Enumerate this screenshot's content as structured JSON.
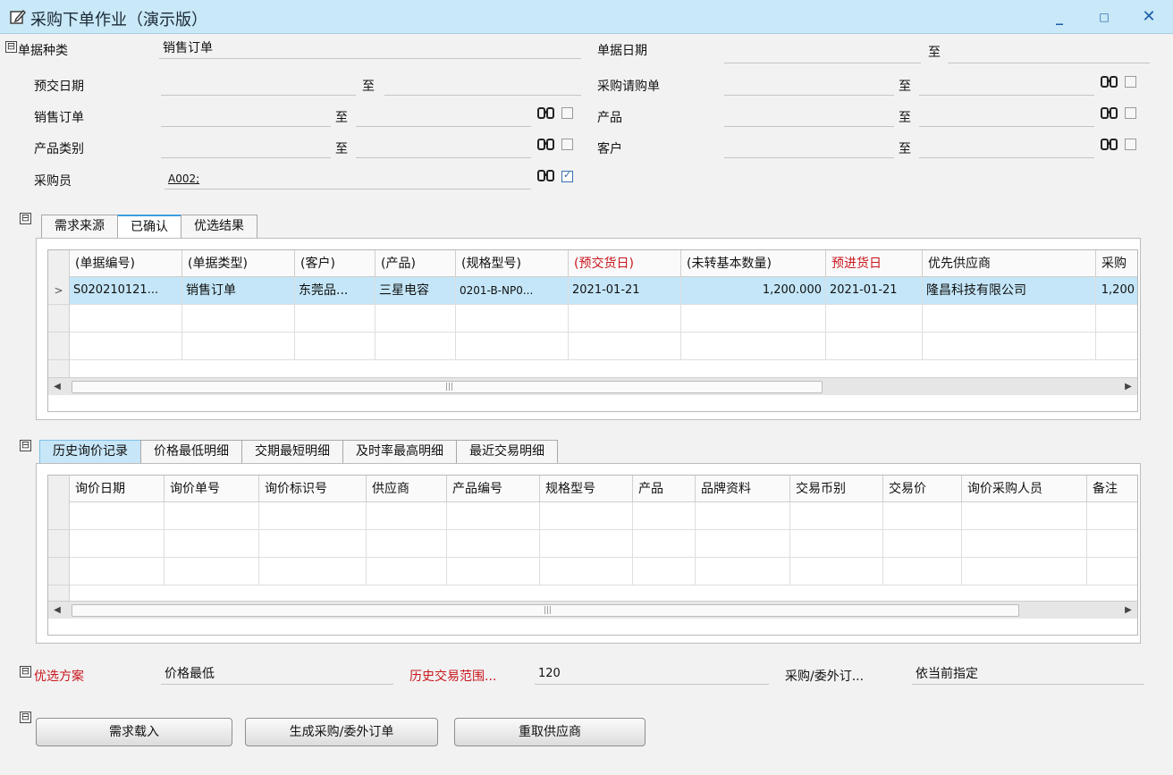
{
  "window": {
    "title": "采购下单作业（演示版）",
    "min_glyph": "_",
    "max_glyph": "□",
    "close_glyph": "✕"
  },
  "icons": {
    "edit": "edit-icon",
    "binoculars": "binoculars-icon",
    "collapse": "collapse-icon"
  },
  "filters": {
    "doc_type": {
      "label": "单据种类",
      "value": "销售订单"
    },
    "doc_date": {
      "label": "单据日期",
      "from": "",
      "to_label": "至",
      "to": ""
    },
    "delivery_date": {
      "label": "预交日期",
      "from": "",
      "to_label": "至",
      "to": ""
    },
    "purchase_request": {
      "label": "采购请购单",
      "from": "",
      "to_label": "至",
      "to": ""
    },
    "sales_order": {
      "label": "销售订单",
      "from": "",
      "to_label": "至",
      "to": ""
    },
    "product": {
      "label": "产品",
      "from": "",
      "to_label": "至",
      "to": ""
    },
    "product_category": {
      "label": "产品类别",
      "from": "",
      "to_label": "至",
      "to": ""
    },
    "customer": {
      "label": "客户",
      "from": "",
      "to_label": "至",
      "to": ""
    },
    "buyer": {
      "label": "采购员",
      "value": "A002;"
    },
    "binoculars_text": "M",
    "collapse_glyph": "⊟"
  },
  "tabs_top": [
    "需求来源",
    "已确认",
    "优选结果"
  ],
  "grid_top": {
    "columns": [
      "(单据编号)",
      "(单据类型)",
      "(客户)",
      "(产品)",
      "(规格型号)",
      "(预交货日)",
      "(未转基本数量)",
      "预进货日",
      "优先供应商",
      "采购"
    ],
    "rows": [
      [
        "S020210121...",
        "销售订单",
        "东莞品...",
        "三星电容",
        "0201-B-NP0...",
        "2021-01-21",
        "1,200.000",
        "2021-01-21",
        "隆昌科技有限公司",
        "1,200"
      ]
    ],
    "row_marker": ">",
    "scroll_left": "◀",
    "scroll_right": "▶",
    "scroll_grip": "|||"
  },
  "tabs_bottom": [
    "历史询价记录",
    "价格最低明细",
    "交期最短明细",
    "及时率最高明细",
    "最近交易明细"
  ],
  "grid_bottom": {
    "columns": [
      "询价日期",
      "询价单号",
      "询价标识号",
      "供应商",
      "产品编号",
      "规格型号",
      "产品",
      "品牌资料",
      "交易币别",
      "交易价",
      "询价采购人员",
      "备注"
    ]
  },
  "options": {
    "preferred_scheme": {
      "label": "优选方案",
      "value": "价格最低"
    },
    "history_range": {
      "label": "历史交易范围...",
      "value": "120"
    },
    "purchase_outsource": {
      "label": "采购/委外订...",
      "value": "依当前指定"
    }
  },
  "buttons": {
    "load_demand": "需求载入",
    "generate_order": "生成采购/委外订单",
    "refetch_supplier": "重取供应商"
  },
  "colors": {
    "accent": "#3b9ee0",
    "title_bg": "#c9e8f8",
    "selected_row": "#c4e6f8",
    "required_label": "#c8161d"
  }
}
